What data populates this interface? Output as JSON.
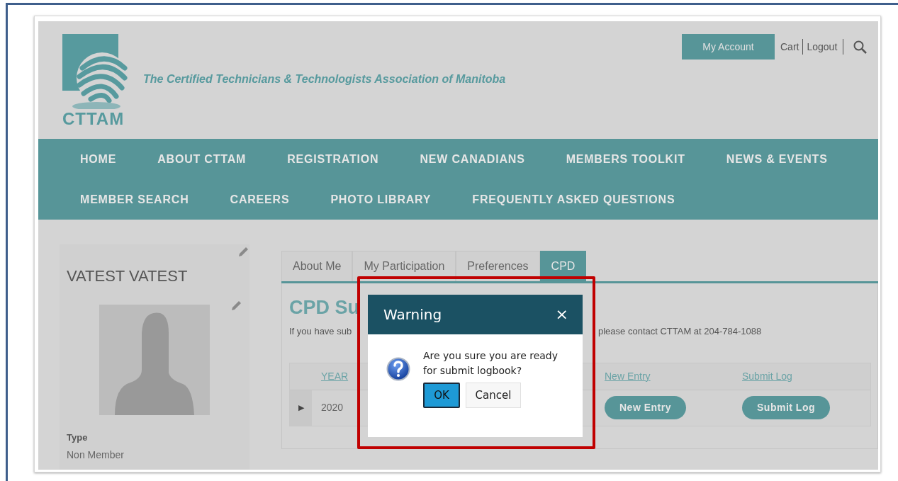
{
  "header": {
    "logo_text": "CTTAM",
    "tagline": "The Certified Technicians & Technologists Association of Manitoba",
    "account_button": "My Account",
    "links": [
      "Cart",
      "Logout"
    ]
  },
  "nav": {
    "rows": [
      [
        "HOME",
        "ABOUT CTTAM",
        "REGISTRATION",
        "NEW CANADIANS",
        "MEMBERS TOOLKIT",
        "NEWS & EVENTS"
      ],
      [
        "MEMBER SEARCH",
        "CAREERS",
        "PHOTO LIBRARY",
        "FREQUENTLY ASKED QUESTIONS"
      ]
    ]
  },
  "profile": {
    "name": "VATEST VATEST",
    "fields": [
      {
        "label": "Type",
        "value": "Non Member"
      }
    ]
  },
  "tabs": [
    {
      "label": "About Me",
      "selected": false
    },
    {
      "label": "My Participation",
      "selected": false
    },
    {
      "label": "Preferences",
      "selected": false
    },
    {
      "label": "CPD",
      "selected": true
    }
  ],
  "cpd": {
    "heading": "CPD Su",
    "note_start": "If you have sub",
    "note_end": "please contact CTTAM at 204-784-1088",
    "table": {
      "columns": [
        "YEAR",
        "New Entry",
        "Submit Log"
      ],
      "rows": [
        {
          "expander": "▶",
          "year": "2020",
          "buttons": [
            "New Entry",
            "Submit Log"
          ]
        }
      ]
    }
  },
  "dialog": {
    "title": "Warning",
    "close": "×",
    "message": "Are you sure you are ready for submit logbook?",
    "buttons": [
      {
        "label": "OK",
        "selected": true
      },
      {
        "label": "Cancel",
        "selected": false
      }
    ]
  }
}
